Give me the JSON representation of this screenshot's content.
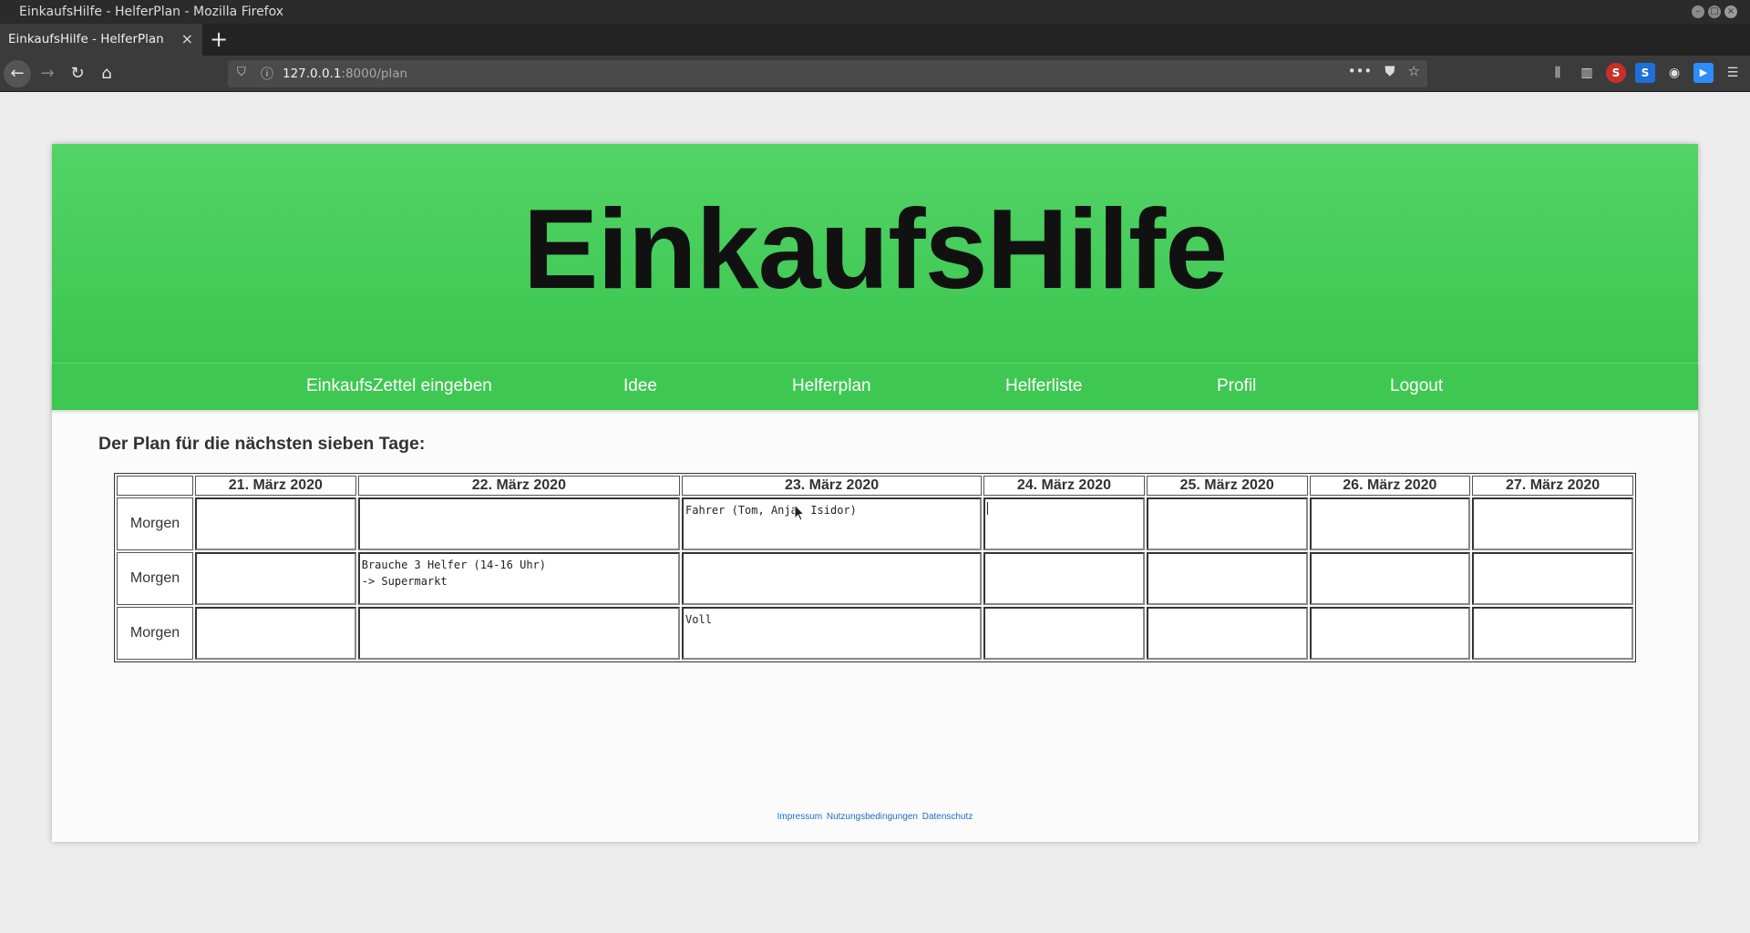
{
  "window": {
    "title": "EinkaufsHilfe - HelferPlan - Mozilla Firefox"
  },
  "tabs": [
    {
      "label": "EinkaufsHilfe - HelferPlan"
    }
  ],
  "address": {
    "host": "127.0.0.1",
    "rest": ":8000/plan"
  },
  "site": {
    "title": "EinkaufsHilfe",
    "menu": [
      "EinkaufsZettel eingeben",
      "Idee",
      "Helferplan",
      "Helferliste",
      "Profil",
      "Logout"
    ]
  },
  "plan": {
    "heading": "Der Plan für die nächsten sieben Tage:",
    "days": [
      "21. März 2020",
      "22. März 2020",
      "23. März 2020",
      "24. März 2020",
      "25. März 2020",
      "26. März 2020",
      "27. März 2020"
    ],
    "rows": [
      {
        "label": "Morgen",
        "cells": [
          "",
          "",
          "Fahrer (Tom, Anja, Isidor)",
          "",
          "",
          "",
          ""
        ]
      },
      {
        "label": "Morgen",
        "cells": [
          "",
          "Brauche 3 Helfer (14-16 Uhr)\n-> Supermarkt",
          "",
          "",
          "",
          "",
          ""
        ]
      },
      {
        "label": "Morgen",
        "cells": [
          "",
          "",
          "Voll",
          "",
          "",
          "",
          ""
        ]
      }
    ]
  },
  "footer": {
    "links": [
      "Impressum",
      "Nutzungsbedingungen",
      "Datenschutz"
    ]
  },
  "icons": {
    "toolbar": [
      "library-icon",
      "sidebar-icon",
      "extension-s-icon",
      "skype-icon",
      "account-icon",
      "zoom-icon",
      "menu-icon"
    ]
  },
  "colors": {
    "hero_top": "#52d466",
    "hero_bottom": "#3cc650",
    "menu": "#3ec852",
    "link": "#1d6fc6"
  }
}
